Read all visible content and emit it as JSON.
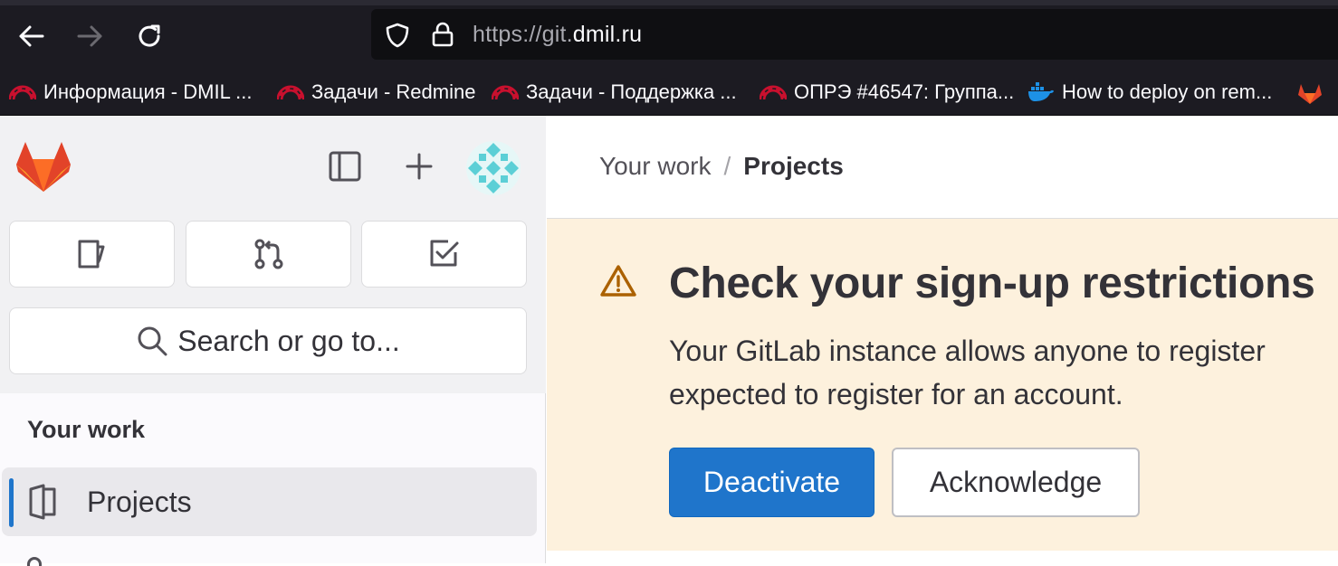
{
  "browser": {
    "url_prefix": "https://git.",
    "url_domain": "dmil.ru",
    "icons": [
      "back-arrow-icon",
      "forward-arrow-icon",
      "reload-icon",
      "shield-icon",
      "lock-icon"
    ]
  },
  "bookmarks": [
    {
      "label": "Информация - DMIL ...",
      "icon": "redmine-icon"
    },
    {
      "label": "Задачи - Redmine",
      "icon": "redmine-icon"
    },
    {
      "label": "Задачи - Поддержка ...",
      "icon": "redmine-icon"
    },
    {
      "label": "ОПРЭ #46547: Группа...",
      "icon": "redmine-icon"
    },
    {
      "label": "How to deploy on rem...",
      "icon": "docker-icon"
    },
    {
      "label": "",
      "icon": "gitlab-icon"
    }
  ],
  "sidebar": {
    "search_label": "Search or go to...",
    "section_title": "Your work",
    "nav_items": [
      {
        "label": "Projects",
        "active": true
      }
    ]
  },
  "breadcrumb": {
    "parent": "Your work",
    "separator": "/",
    "current": "Projects"
  },
  "alert": {
    "title": "Check your sign-up restrictions",
    "body_line1": "Your GitLab instance allows anyone to register",
    "body_line2": "expected to register for an account.",
    "primary_button": "Deactivate",
    "secondary_button": "Acknowledge"
  },
  "colors": {
    "accent": "#1f75cb",
    "alert_bg": "#fdf1dd",
    "warning": "#ab6100",
    "browser_bg": "#1c1b22"
  }
}
